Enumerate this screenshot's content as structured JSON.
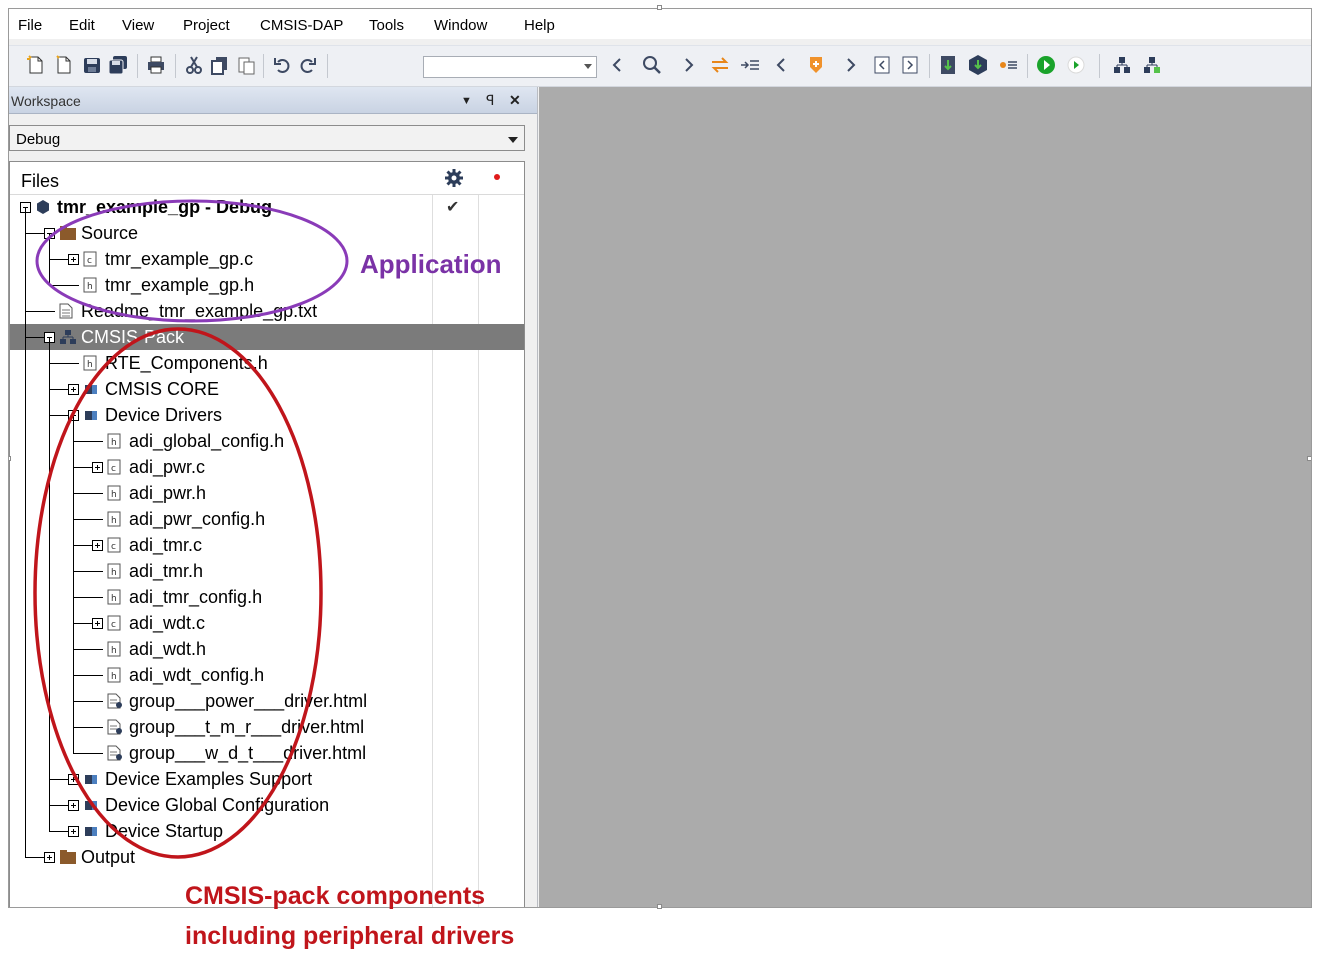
{
  "menu": [
    "File",
    "Edit",
    "View",
    "Project",
    "CMSIS-DAP",
    "Tools",
    "Window",
    "Help"
  ],
  "toolbar": {
    "icons": [
      "new-file-icon",
      "open-file-icon",
      "save-icon",
      "save-all-icon",
      "print-icon",
      "cut-icon",
      "copy-icon",
      "paste-icon",
      "undo-icon",
      "redo-icon",
      "navigate-back-icon",
      "find-icon",
      "navigate-forward-icon",
      "toggle-bookmark-icon",
      "next-bookmark-icon",
      "previous-icon",
      "breakpoint-icon",
      "next-icon",
      "go-to-previous-icon",
      "go-to-next-icon",
      "compile-icon",
      "download-icon",
      "stop-build-icon",
      "debug-icon",
      "run-icon",
      "manage-packs-icon",
      "manage-components-icon"
    ],
    "find_value": ""
  },
  "workspace": {
    "title": "Workspace",
    "config": "Debug",
    "files_header": "Files",
    "tree": [
      {
        "label": "tmr_example_gp - Debug",
        "icon": "project-icon",
        "checked": true
      },
      {
        "label": "Source",
        "icon": "folder-icon"
      },
      {
        "label": "tmr_example_gp.c",
        "icon": "c-file-icon"
      },
      {
        "label": "tmr_example_gp.h",
        "icon": "h-file-icon"
      },
      {
        "label": "Readme_tmr_example_gp.txt",
        "icon": "text-file-icon"
      },
      {
        "label": "CMSIS-Pack",
        "icon": "cmsis-pack-icon"
      },
      {
        "label": "RTE_Components.h",
        "icon": "h-file-icon"
      },
      {
        "label": "CMSIS CORE",
        "icon": "component-icon"
      },
      {
        "label": "Device Drivers",
        "icon": "component-icon"
      },
      {
        "label": "adi_global_config.h",
        "icon": "h-file-icon"
      },
      {
        "label": "adi_pwr.c",
        "icon": "c-file-icon"
      },
      {
        "label": "adi_pwr.h",
        "icon": "h-file-icon"
      },
      {
        "label": "adi_pwr_config.h",
        "icon": "h-file-icon"
      },
      {
        "label": "adi_tmr.c",
        "icon": "c-file-icon"
      },
      {
        "label": "adi_tmr.h",
        "icon": "h-file-icon"
      },
      {
        "label": "adi_tmr_config.h",
        "icon": "h-file-icon"
      },
      {
        "label": "adi_wdt.c",
        "icon": "c-file-icon"
      },
      {
        "label": "adi_wdt.h",
        "icon": "h-file-icon"
      },
      {
        "label": "adi_wdt_config.h",
        "icon": "h-file-icon"
      },
      {
        "label": "group___power___driver.html",
        "icon": "html-doc-icon"
      },
      {
        "label": "group___t_m_r___driver.html",
        "icon": "html-doc-icon"
      },
      {
        "label": "group___w_d_t___driver.html",
        "icon": "html-doc-icon"
      },
      {
        "label": "Device Examples Support",
        "icon": "component-icon"
      },
      {
        "label": "Device Global Configuration",
        "icon": "component-icon"
      },
      {
        "label": "Device Startup",
        "icon": "component-icon"
      },
      {
        "label": "Output",
        "icon": "folder-icon"
      }
    ]
  },
  "annotations": {
    "application": "Application",
    "cmsis_line1": "CMSIS-pack components",
    "cmsis_line2": "including peripheral drivers"
  },
  "colors": {
    "application": "#7a32a6",
    "cmsis": "#c0151b",
    "selected_row": "#7b7b7b",
    "editor_bg": "#ababab"
  }
}
